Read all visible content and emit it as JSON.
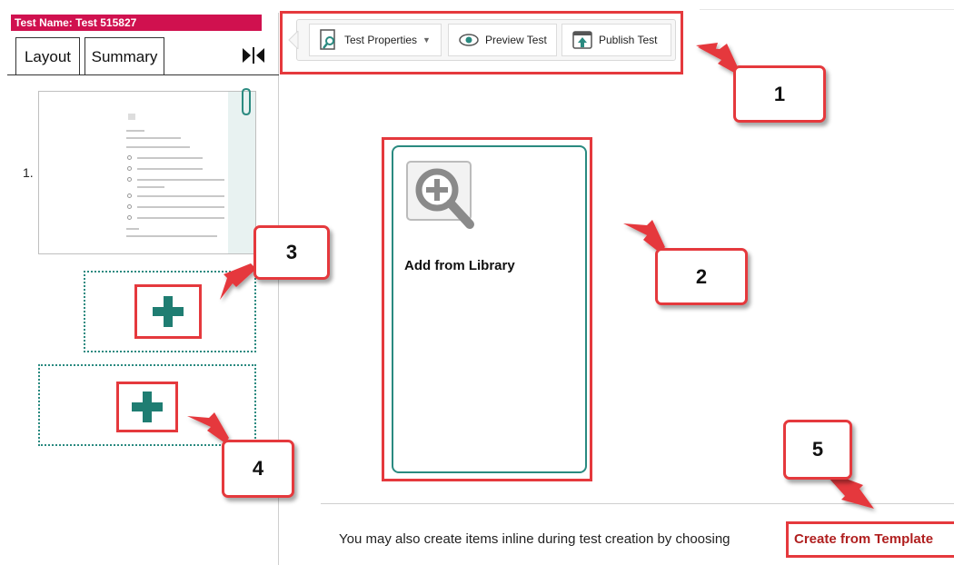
{
  "header": {
    "test_name": "Test Name: Test 515827"
  },
  "tabs": [
    {
      "label": "Layout"
    },
    {
      "label": "Summary"
    }
  ],
  "layout": {
    "item_number": "1."
  },
  "toolbar": {
    "test_properties": "Test Properties",
    "preview_test": "Preview Test",
    "publish_test": "Publish Test"
  },
  "library": {
    "label": "Add from Library"
  },
  "footer": {
    "text": "You may also create items inline during test creation by choosing",
    "link": "Create from Template"
  },
  "callouts": [
    "1",
    "2",
    "3",
    "4",
    "5"
  ],
  "colors": {
    "callout_red": "#e5393d",
    "teal": "#2a8a80",
    "header_pink": "#d0114f",
    "link_red": "#b01f1f"
  },
  "icons": [
    "collapse-icon",
    "paperclip-icon",
    "test-properties-icon",
    "chevron-down-icon",
    "eye-icon",
    "publish-icon",
    "plus-icon",
    "magnifier-plus-icon"
  ]
}
